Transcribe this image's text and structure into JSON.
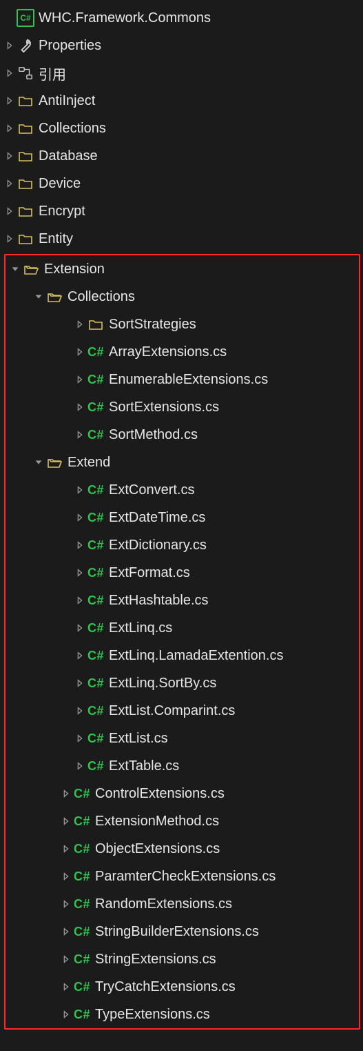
{
  "project": {
    "name": "WHC.Framework.Commons"
  },
  "top_level": {
    "properties": "Properties",
    "references": "引用",
    "folders": [
      "AntiInject",
      "Collections",
      "Database",
      "Device",
      "Encrypt",
      "Entity"
    ]
  },
  "extension": {
    "label": "Extension",
    "collections": {
      "label": "Collections",
      "folder": "SortStrategies",
      "files": [
        "ArrayExtensions.cs",
        "EnumerableExtensions.cs",
        "SortExtensions.cs",
        "SortMethod.cs"
      ]
    },
    "extend": {
      "label": "Extend",
      "files": [
        "ExtConvert.cs",
        "ExtDateTime.cs",
        "ExtDictionary.cs",
        "ExtFormat.cs",
        "ExtHashtable.cs",
        "ExtLinq.cs",
        "ExtLinq.LamadaExtention.cs",
        "ExtLinq.SortBy.cs",
        "ExtList.Comparint.cs",
        "ExtList.cs",
        "ExtTable.cs"
      ]
    },
    "files": [
      "ControlExtensions.cs",
      "ExtensionMethod.cs",
      "ObjectExtensions.cs",
      "ParamterCheckExtensions.cs",
      "RandomExtensions.cs",
      "StringBuilderExtensions.cs",
      "StringExtensions.cs",
      "TryCatchExtensions.cs",
      "TypeExtensions.cs"
    ]
  },
  "cs_icon_text": "C#"
}
